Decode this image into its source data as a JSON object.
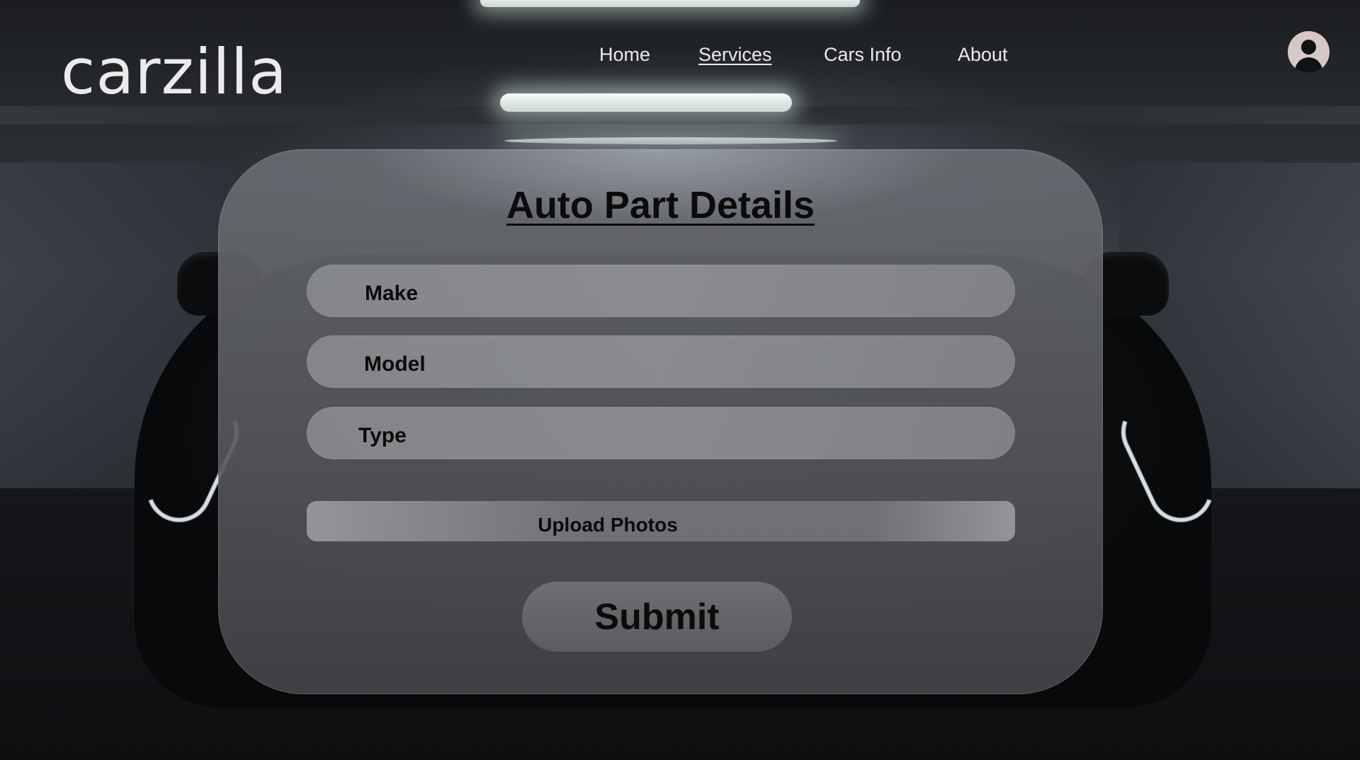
{
  "brand": {
    "logo_text": "carzilla"
  },
  "nav": {
    "items": [
      {
        "label": "Home",
        "active": false
      },
      {
        "label": "Services",
        "active": true
      },
      {
        "label": "Cars Info",
        "active": false
      },
      {
        "label": "About",
        "active": false
      }
    ],
    "account_icon": "user-circle-icon"
  },
  "form": {
    "title": "Auto Part Details",
    "fields": {
      "make": {
        "placeholder": "Make",
        "value": ""
      },
      "model": {
        "placeholder": "Model",
        "value": ""
      },
      "type": {
        "placeholder": "Type",
        "value": ""
      }
    },
    "upload_label": "Upload Photos",
    "submit_label": "Submit"
  },
  "colors": {
    "text_light": "#eceaea",
    "text_dark": "#0b0b0b",
    "avatar": "#d7c8c8"
  }
}
